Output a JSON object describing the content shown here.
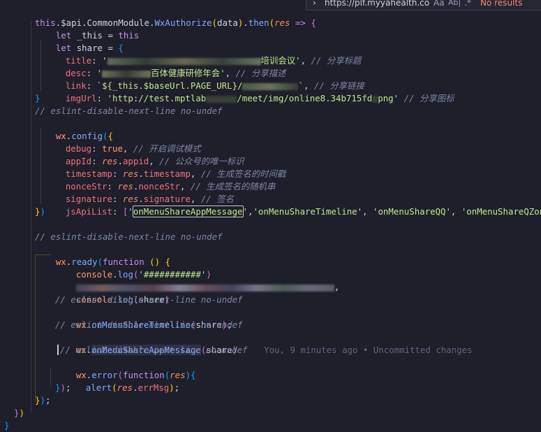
{
  "find_widget": {
    "toggle_glyph": "›",
    "query": "https://plf.myyahealth.co",
    "match_case_glyph": "Aa",
    "whole_word_glyph": "Ab|",
    "regex_glyph": ".*",
    "result_text": "No results"
  },
  "code": {
    "l1_this": "this",
    "l1_api": ".$api.",
    "l1_module": "CommonModule",
    "l1_method": "WxAuthorize",
    "l1_data": "data",
    "l1_then": "then",
    "l1_res": "res",
    "l2_let": "let",
    "l2_name": " _this = ",
    "l2_this": "this",
    "l3_let": "let",
    "l3_name": " share = ",
    "title_key": "title",
    "title_val_tail": "培训会议'",
    "title_cm": "// 分享标题",
    "desc_key": "desc",
    "desc_val_tail": "百体健康研修年会'",
    "desc_cm": "// 分享描述",
    "link_key": "link",
    "link_tpl": "`${_this.$baseUrl.PAGE_URL}/",
    "link_cm": "// 分享链接",
    "img_key": "imgUrl",
    "img_val_a": "'http://test.mptlab",
    "img_val_b": "/meet/img/online8.34b715fd",
    "img_val_c": "png'",
    "img_cm": "// 分享图标",
    "lint1": "// eslint-disable-next-line no-undef",
    "wx": "wx",
    "config": "config",
    "debug_key": "debug",
    "debug_val": "true",
    "debug_cm": "// 开启调试模式",
    "appid_key": "appId",
    "appid_val": "appid",
    "appid_cm": "// 公众号的唯一标识",
    "ts_key": "timestamp",
    "ts_val": "timestamp",
    "ts_cm": "// 生成签名的时间戳",
    "nonce_key": "nonceStr",
    "nonce_val": "nonceStr",
    "nonce_cm": "// 生成签名的随机串",
    "sig_key": "signature",
    "sig_val": "signature",
    "sig_cm": "// 签名",
    "js_key": "jsApiList",
    "js_api_1": "onMenuShareAppMessage",
    "js_api_2": "'onMenuShareTimeline'",
    "js_api_3": "'onMenuShareQQ'",
    "js_api_4": "'onMenuShareQZone'",
    "lint2": "// eslint-disable-next-line no-undef",
    "ready": "ready",
    "function_kw": "function",
    "console": "console",
    "log": "log",
    "log_str": "'###########'",
    "log_share": "share",
    "lint3": "// eslint-disable-next-line no-undef",
    "timeline": "onMenuShareTimeline",
    "share_arg": "share",
    "lint4": "// eslint-disable-next-line no-undef",
    "appmsg": "onMenuShareAppMessage",
    "blame": "You, 9 minutes ago • Uncommitted changes",
    "lint5": "// eslint-disable-next-line no-undef",
    "error": "error",
    "res_param": "res",
    "alert": "alert",
    "errmsg": "errMsg"
  }
}
